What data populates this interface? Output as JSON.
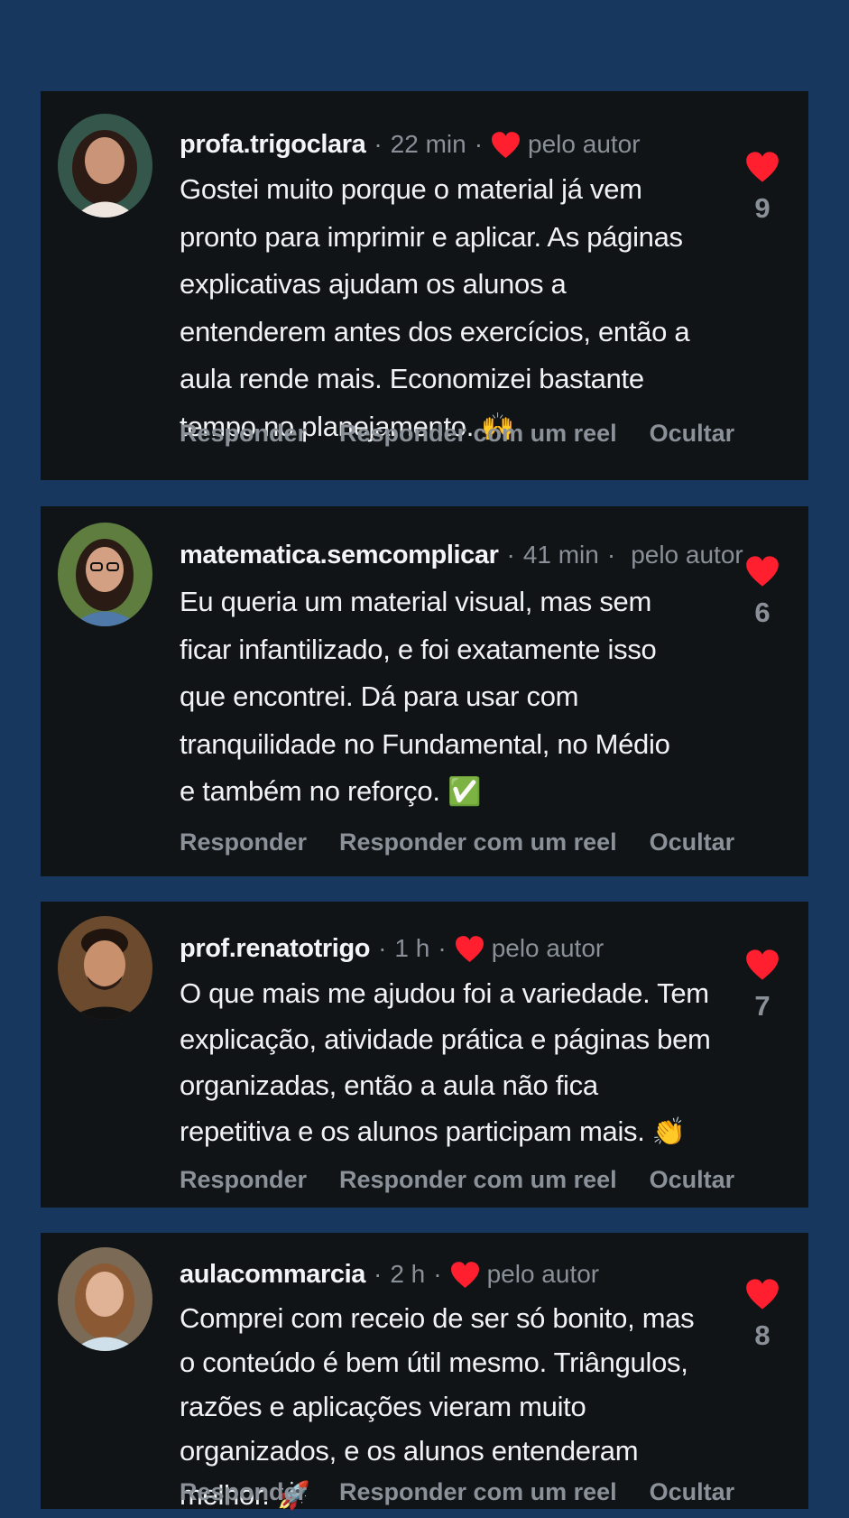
{
  "comments": [
    {
      "username": "profa.trigoclara",
      "time": "22 min",
      "liked_by_author_label": "pelo autor",
      "text": "Gostei muito porque o material já vem pronto para imprimir e aplicar. As páginas explicativas ajudam os alunos a entenderem antes dos exercícios, então a aula rende mais. Economizei bastante tempo no planejamento.",
      "emoji": "🙌",
      "likes": "9",
      "actions": {
        "reply": "Responder",
        "reply_reel": "Responder com um reel",
        "hide": "Ocultar"
      }
    },
    {
      "username": "matematica.semcomplicar",
      "time": "41 min",
      "liked_by_author_label": "pelo autor",
      "text": "Eu queria um material visual, mas sem ficar infantilizado, e foi exatamente isso que encontrei. Dá para usar com tranquilidade no Fundamental, no Médio e também no reforço.",
      "emoji": "✅",
      "likes": "6",
      "actions": {
        "reply": "Responder",
        "reply_reel": "Responder com um reel",
        "hide": "Ocultar"
      }
    },
    {
      "username": "prof.renatotrigo",
      "time": "1 h",
      "liked_by_author_label": "pelo autor",
      "text": "O que mais me ajudou foi a variedade. Tem explicação, atividade prática e páginas bem organizadas, então a aula não fica repetitiva e os alunos participam mais.",
      "emoji": "👏",
      "likes": "7",
      "actions": {
        "reply": "Responder",
        "reply_reel": "Responder com um reel",
        "hide": "Ocultar"
      }
    },
    {
      "username": "aulacommarcia",
      "time": "2 h",
      "liked_by_author_label": "pelo autor",
      "text": "Comprei com receio de ser só bonito, mas o conteúdo é bem útil mesmo. Triângulos, razões e aplicações vieram muito organizados, e os alunos entenderam melhor.",
      "emoji": "🚀",
      "likes": "8",
      "actions": {
        "reply": "Responder",
        "reply_reel": "Responder com um reel",
        "hide": "Ocultar"
      }
    }
  ],
  "colors": {
    "page_background": "#17375f",
    "card_background": "#111417",
    "heart": "#ff1f2e",
    "muted_text": "#8a9098",
    "primary_text": "#f1f2f3"
  },
  "icons": {
    "like": "heart-icon",
    "author_like": "heart-icon"
  }
}
